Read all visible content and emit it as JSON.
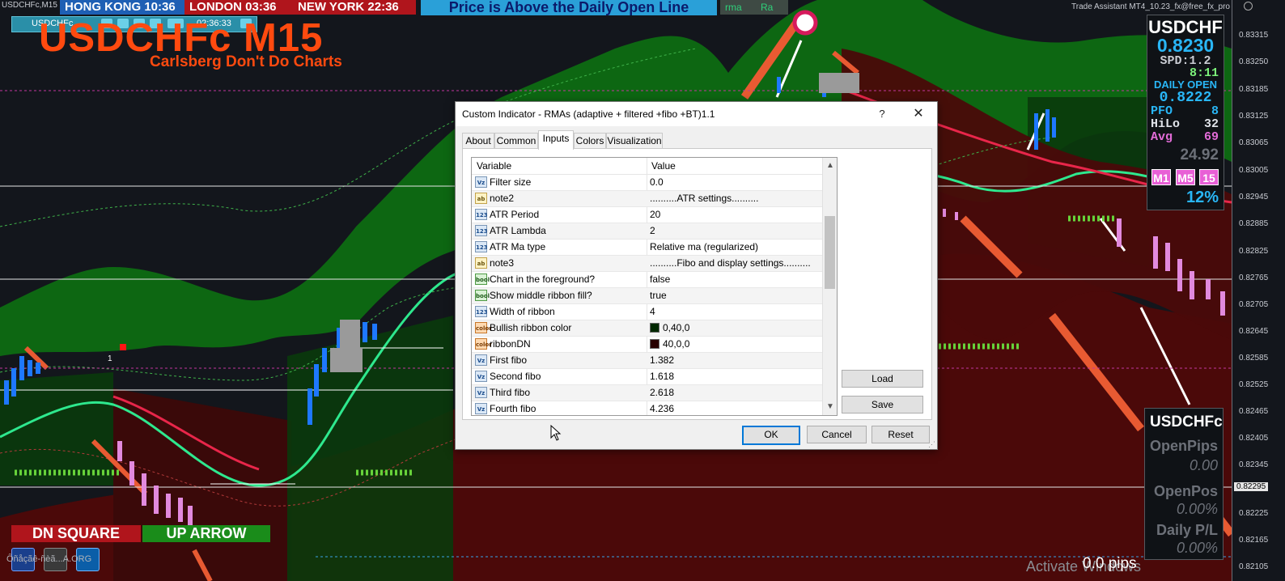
{
  "chart_window": {
    "tab_title": "USDCHFc,M15",
    "symbol_title": "USDCHFc M15",
    "subtitle": "Carlsberg Don't Do Charts",
    "toolbar_symbol": "USDCHFc",
    "toolbar_time": "02:36:33",
    "top_right_text": "Trade Assistant MT4_10.23_fx@free_fx_pro",
    "bar_label": "1"
  },
  "clocks": [
    {
      "label": "HONG KONG 10:36",
      "bg": "#1e5fb4"
    },
    {
      "label": "LONDON  03:36",
      "bg": "#b0151c"
    },
    {
      "label": "NEW YORK  22:36",
      "bg": "#b0151c"
    }
  ],
  "banner": {
    "text": "Price is Above the Daily Open Line",
    "tab1": "rma",
    "tab2": "Ra"
  },
  "price_axis": [
    "0.83315",
    "0.83250",
    "0.83185",
    "0.83125",
    "0.83065",
    "0.83005",
    "0.82945",
    "0.82885",
    "0.82825",
    "0.82765",
    "0.82705",
    "0.82645",
    "0.82585",
    "0.82525",
    "0.82465",
    "0.82405",
    "0.82345",
    "0.82295",
    "0.82225",
    "0.82165",
    "0.82105"
  ],
  "info_panel": {
    "symbol": "USDCHF",
    "price": "0.8230",
    "spread": "SPD:1.2",
    "timer": "8:11",
    "daily_open_label": "DAILY OPEN",
    "daily_open": "0.8222",
    "pfo_label": "PFO",
    "pfo": "8",
    "hilo_label": "HiLo",
    "hilo": "32",
    "avg_label": "Avg",
    "avg": "69",
    "atr_value": "24.92",
    "timeframes": [
      "M1",
      "M5",
      "15"
    ],
    "percent": "12%"
  },
  "position_panel": {
    "symbol": "USDCHFc",
    "open_pips_label": "OpenPips",
    "open_pips": "0.00",
    "open_pos_label": "OpenPos",
    "open_pos": "0.00%",
    "daily_pl_label": "Daily P/L",
    "daily_pl": "0.00%"
  },
  "signals": {
    "dn_square": "DN SQUARE",
    "up_arrow": "UP ARROW"
  },
  "bottom": {
    "link_text": "Ôñåçãê-ñèã...A.ORG",
    "pips": "0.0 pips",
    "watermark": "Activate Windows"
  },
  "dialog": {
    "title": "Custom Indicator - RMAs (adaptive + filtered +fibo +BT)1.1",
    "help": "?",
    "close": "✕",
    "tabs": [
      "About",
      "Common",
      "Inputs",
      "Colors",
      "Visualization"
    ],
    "active_tab": "Inputs",
    "columns": {
      "variable": "Variable",
      "value": "Value"
    },
    "rows": [
      {
        "icon": "Vz",
        "name": "Filter size",
        "value": "0.0"
      },
      {
        "icon": "ab",
        "name": "note2",
        "value": "..........ATR settings.........."
      },
      {
        "icon": "123",
        "name": "ATR Period",
        "value": "20"
      },
      {
        "icon": "123",
        "name": "ATR Lambda",
        "value": "2"
      },
      {
        "icon": "123",
        "name": "ATR Ma type",
        "value": "Relative ma (regularized)"
      },
      {
        "icon": "ab",
        "name": "note3",
        "value": "..........Fibo and display settings.........."
      },
      {
        "icon": "bool",
        "name": "Chart in the foreground?",
        "value": "false"
      },
      {
        "icon": "bool",
        "name": "Show middle ribbon fill?",
        "value": "true"
      },
      {
        "icon": "123",
        "name": "Width of ribbon",
        "value": "4"
      },
      {
        "icon": "color",
        "name": "Bullish ribbon  color",
        "value": "0,40,0",
        "swatch": "#002800"
      },
      {
        "icon": "color",
        "name": "ribbonDN",
        "value": "40,0,0",
        "swatch": "#280000"
      },
      {
        "icon": "Vz",
        "name": "First fibo",
        "value": "1.382"
      },
      {
        "icon": "Vz",
        "name": "Second fibo",
        "value": "1.618"
      },
      {
        "icon": "Vz",
        "name": "Third fibo",
        "value": "2.618"
      },
      {
        "icon": "Vz",
        "name": "Fourth fibo",
        "value": "4.236"
      }
    ],
    "buttons": {
      "load": "Load",
      "save": "Save",
      "ok": "OK",
      "cancel": "Cancel",
      "reset": "Reset"
    }
  },
  "colors": {
    "bull_ribbon": "#0f6a14",
    "bear_ribbon": "#5a0b0b",
    "ma_green": "#2ee88e",
    "ma_red": "#e8264a",
    "orange": "#e85a32",
    "candle_up": "#1e78ff",
    "candle_down": "#e28ade",
    "annotation_arrow": "#e0141a"
  }
}
